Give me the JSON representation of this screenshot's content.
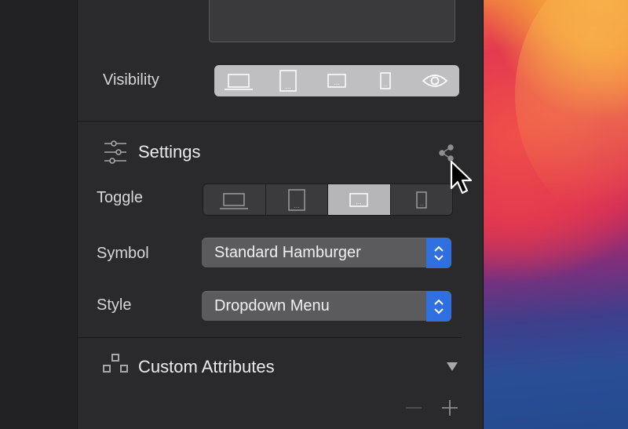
{
  "visibility": {
    "label": "Visibility",
    "devices": [
      "desktop-icon",
      "tablet-icon",
      "landscape-phone-icon",
      "phone-icon",
      "eye-icon"
    ]
  },
  "settings": {
    "title": "Settings",
    "icon": "sliders-icon",
    "share_icon": "share-icon",
    "toggle": {
      "label": "Toggle",
      "options": [
        "desktop-icon",
        "tablet-icon",
        "landscape-phone-icon",
        "phone-icon"
      ],
      "active_index": 2
    },
    "symbol": {
      "label": "Symbol",
      "value": "Standard Hamburger"
    },
    "style": {
      "label": "Style",
      "value": "Dropdown Menu"
    }
  },
  "custom_attributes": {
    "title": "Custom Attributes",
    "icon": "blocks-icon",
    "collapse_icon": "triangle-down-icon",
    "remove_icon": "minus-icon",
    "add_icon": "plus-icon"
  },
  "colors": {
    "accent": "#2f6fe0",
    "panel": "#2a2a2c",
    "segment_active": "#b6b6b8"
  }
}
